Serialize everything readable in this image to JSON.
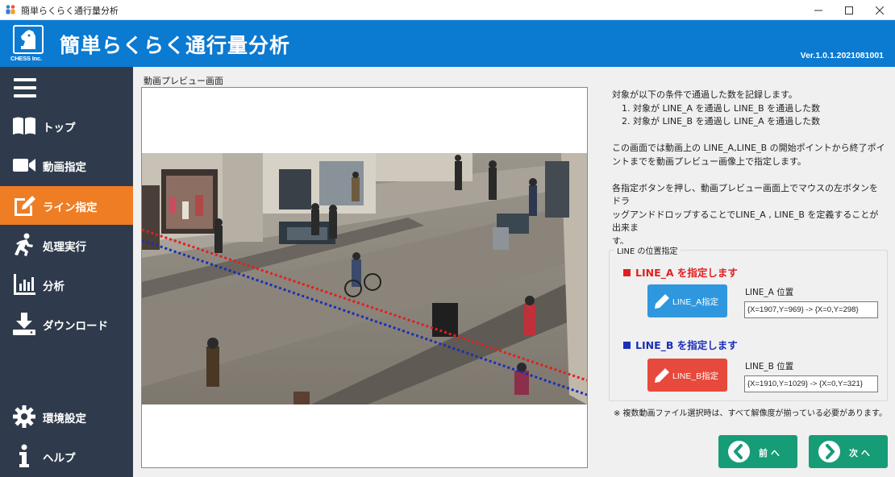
{
  "window": {
    "title": "簡単らくらく通行量分析"
  },
  "header": {
    "company": "CHESS Inc.",
    "app_title": "簡単らくらく通行量分析",
    "version": "Ver.1.0.1.2021081001",
    "brand_color": "#0b7ad1"
  },
  "sidebar": {
    "bg_color": "#2f3b4c",
    "active_color": "#ee7d24",
    "items": [
      {
        "label": "トップ",
        "icon": "book-icon"
      },
      {
        "label": "動画指定",
        "icon": "video-camera-icon"
      },
      {
        "label": "ライン指定",
        "icon": "edit-icon",
        "active": true
      },
      {
        "label": "処理実行",
        "icon": "running-person-icon"
      },
      {
        "label": "分析",
        "icon": "bar-chart-icon"
      },
      {
        "label": "ダウンロード",
        "icon": "download-icon"
      },
      {
        "label": "環境設定",
        "icon": "gear-icon"
      },
      {
        "label": "ヘルプ",
        "icon": "info-icon"
      }
    ]
  },
  "main": {
    "preview_label": "動画プレビュー画面",
    "description": {
      "line1": "対象が以下の条件で通過した数を記録します。",
      "line2": "1. 対象が LINE_A を通過し LINE_B を通過した数",
      "line3": "2. 対象が LINE_B を通過し LINE_A を通過した数",
      "line4": "この画面では動画上の LINE_A,LINE_B の開始ポイントから終了ポイ",
      "line5": "ントまでを動画プレビュー画像上で指定します。",
      "line6": "各指定ボタンを押し、動画プレビュー画面上でマウスの左ボタンをドラ",
      "line7": "ッグアンドドロップすることでLINE_A , LINE_B を定義することが出来ま",
      "line8": "す。"
    },
    "group_title": "LINE の位置指定",
    "line_a": {
      "heading": "LINE_A を指定します",
      "button": "LINE_A指定",
      "pos_label": "LINE_A 位置",
      "pos_value": "{X=1907,Y=969} -> {X=0,Y=298}",
      "color": "#e02020",
      "button_color": "#2f97de"
    },
    "line_b": {
      "heading": "LINE_B を指定します",
      "button": "LINE_B指定",
      "pos_label": "LINE_B 位置",
      "pos_value": "{X=1910,Y=1029} -> {X=0,Y=321}",
      "color": "#1a2fb8",
      "button_color": "#e7493c"
    },
    "note": "※ 複数動画ファイル選択時は、すべて解像度が揃っている必要があります。",
    "prev_button": "前 へ",
    "next_button": "次 へ",
    "nav_color": "#179c78"
  }
}
